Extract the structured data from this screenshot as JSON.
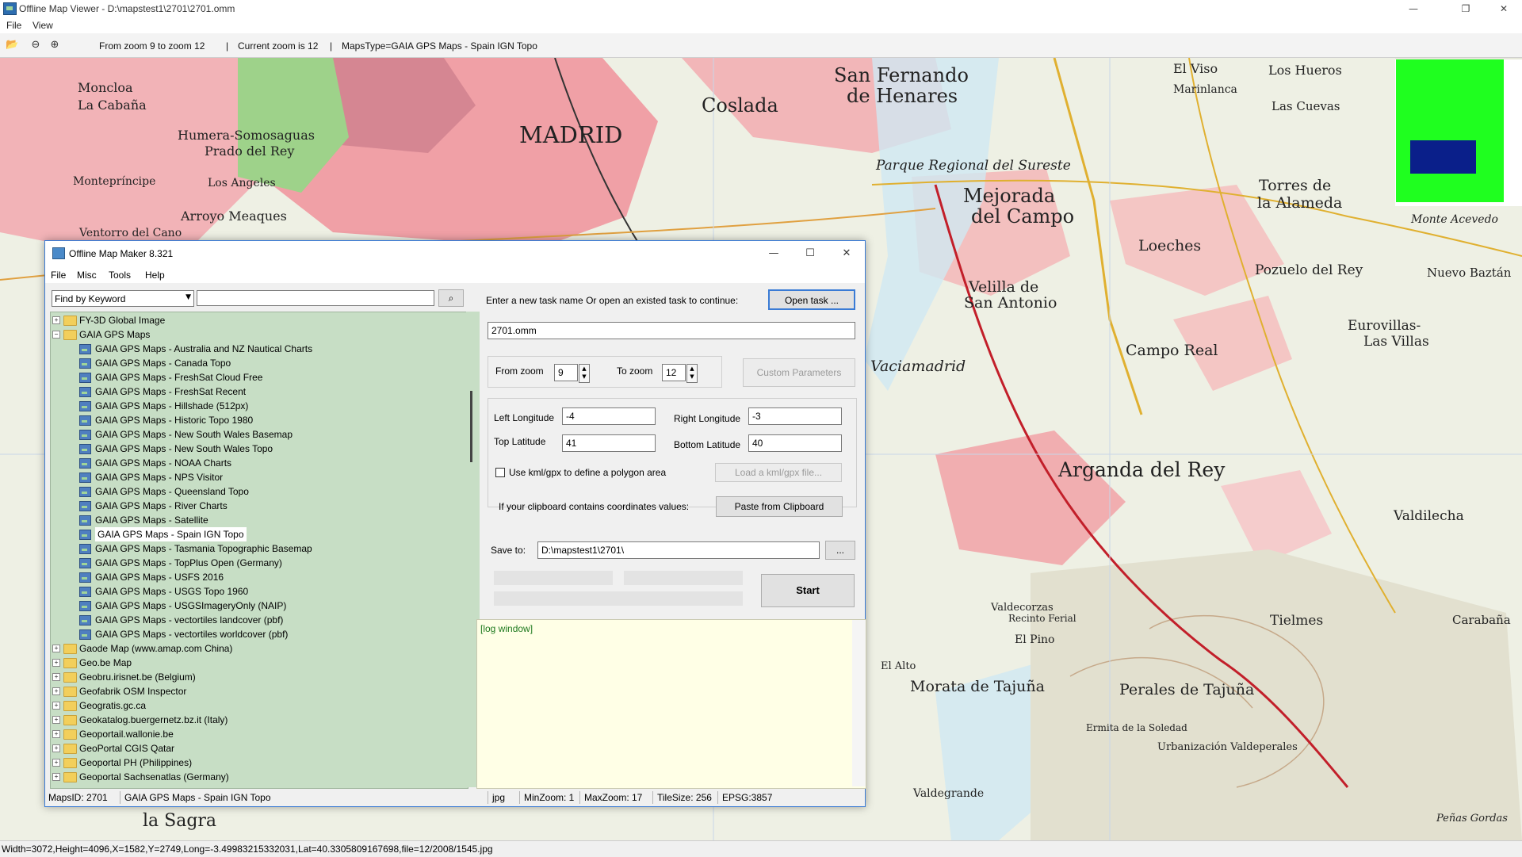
{
  "window": {
    "title": "Offline Map Viewer - D:\\mapstest1\\2701\\2701.omm",
    "controls": [
      "—",
      "❐",
      "✕"
    ]
  },
  "menu": [
    "File",
    "View"
  ],
  "toolbar": {
    "zoom_range": "From zoom 9 to zoom 12",
    "current_zoom": "Current zoom is 12",
    "maps_type": "MapsType=GAIA GPS Maps - Spain IGN Topo"
  },
  "map_labels": [
    "MADRID",
    "San Fernando",
    "de Henares",
    "Coslada",
    "Mejorada",
    "del Campo",
    "Loeches",
    "Torres de",
    "la Alameda",
    "Pozuelo del Rey",
    "Nuevo Baztán",
    "Velilla de",
    "San Antonio",
    "Campo Real",
    "Eurovillas-",
    "Las Villas",
    "Vaciamadrid",
    "Arganda del Rey",
    "Valdilecha",
    "Morata de Tajuña",
    "Perales de Tajuña",
    "Tielmes",
    "Carabaña",
    "Humera-Somosaguas",
    "Prado del Rey",
    "Arroyo Meaques",
    "Moncloa",
    "La Cabaña",
    "Montepríncipe",
    "Los Angeles",
    "Parque Regional del Sureste",
    "El Viso",
    "Los Hueros",
    "Marinlanca",
    "Las Cuevas",
    "Monte Acevedo",
    "Valdecorzas",
    "El Pino",
    "Recinto Ferial",
    "El Alto",
    "Valdegrande",
    "Peñas Gordas",
    "Ventorro del Cano",
    "la Sagra",
    "Urbanización Valdeperales",
    "Ermita de la Soledad"
  ],
  "overview": {
    "frame_color": "#1fff1f",
    "viewport_color": "#0a1f8a"
  },
  "status_bar": "Width=3072,Height=4096,X=1582,Y=2749,Long=-3.49983215332031,Lat=40.3305809167698,file=12/2008/1545.jpg",
  "dialog": {
    "title": "Offline Map Maker 8.321",
    "controls": [
      "—",
      "☐",
      "✕"
    ],
    "menu": [
      "File",
      "Misc",
      "Tools",
      "Help"
    ],
    "search": {
      "mode": "Find by Keyword",
      "query": "",
      "icon": "search-icon"
    },
    "tree": [
      {
        "label": "FY-3D Global Image",
        "level": 0,
        "type": "folder",
        "expander": "+"
      },
      {
        "label": "GAIA GPS Maps",
        "level": 0,
        "type": "folder",
        "expander": "−"
      },
      {
        "label": "GAIA GPS Maps - Australia and NZ Nautical Charts",
        "level": 1,
        "type": "map"
      },
      {
        "label": "GAIA GPS Maps - Canada Topo",
        "level": 1,
        "type": "map"
      },
      {
        "label": "GAIA GPS Maps - FreshSat Cloud Free",
        "level": 1,
        "type": "map"
      },
      {
        "label": "GAIA GPS Maps - FreshSat Recent",
        "level": 1,
        "type": "map"
      },
      {
        "label": "GAIA GPS Maps - Hillshade (512px)",
        "level": 1,
        "type": "map"
      },
      {
        "label": "GAIA GPS Maps - Historic Topo 1980",
        "level": 1,
        "type": "map"
      },
      {
        "label": "GAIA GPS Maps - New South Wales Basemap",
        "level": 1,
        "type": "map"
      },
      {
        "label": "GAIA GPS Maps - New South Wales Topo",
        "level": 1,
        "type": "map"
      },
      {
        "label": "GAIA GPS Maps - NOAA Charts",
        "level": 1,
        "type": "map"
      },
      {
        "label": "GAIA GPS Maps - NPS Visitor",
        "level": 1,
        "type": "map"
      },
      {
        "label": "GAIA GPS Maps - Queensland Topo",
        "level": 1,
        "type": "map"
      },
      {
        "label": "GAIA GPS Maps - River Charts",
        "level": 1,
        "type": "map"
      },
      {
        "label": "GAIA GPS Maps - Satellite",
        "level": 1,
        "type": "map"
      },
      {
        "label": "GAIA GPS Maps - Spain IGN Topo",
        "level": 1,
        "type": "map",
        "selected": true
      },
      {
        "label": "GAIA GPS Maps - Tasmania Topographic Basemap",
        "level": 1,
        "type": "map"
      },
      {
        "label": "GAIA GPS Maps - TopPlus Open (Germany)",
        "level": 1,
        "type": "map"
      },
      {
        "label": "GAIA GPS Maps - USFS 2016",
        "level": 1,
        "type": "map"
      },
      {
        "label": "GAIA GPS Maps - USGS Topo 1960",
        "level": 1,
        "type": "map"
      },
      {
        "label": "GAIA GPS Maps - USGSImageryOnly (NAIP)",
        "level": 1,
        "type": "map"
      },
      {
        "label": "GAIA GPS Maps - vectortiles landcover (pbf)",
        "level": 1,
        "type": "map"
      },
      {
        "label": "GAIA GPS Maps - vectortiles worldcover (pbf)",
        "level": 1,
        "type": "map"
      },
      {
        "label": "Gaode Map (www.amap.com China)",
        "level": 0,
        "type": "folder",
        "expander": "+"
      },
      {
        "label": "Geo.be Map",
        "level": 0,
        "type": "folder",
        "expander": "+"
      },
      {
        "label": "Geobru.irisnet.be (Belgium)",
        "level": 0,
        "type": "folder",
        "expander": "+"
      },
      {
        "label": "Geofabrik OSM Inspector",
        "level": 0,
        "type": "folder",
        "expander": "+"
      },
      {
        "label": "Geogratis.gc.ca",
        "level": 0,
        "type": "folder",
        "expander": "+"
      },
      {
        "label": "Geokatalog.buergernetz.bz.it (Italy)",
        "level": 0,
        "type": "folder",
        "expander": "+"
      },
      {
        "label": "Geoportail.wallonie.be",
        "level": 0,
        "type": "folder",
        "expander": "+"
      },
      {
        "label": "GeoPortal CGIS Qatar",
        "level": 0,
        "type": "folder",
        "expander": "+"
      },
      {
        "label": "Geoportal PH (Philippines)",
        "level": 0,
        "type": "folder",
        "expander": "+"
      },
      {
        "label": "Geoportal Sachsenatlas (Germany)",
        "level": 0,
        "type": "folder",
        "expander": "+"
      }
    ],
    "task": {
      "prompt": "Enter a new task name Or open an existed task to continue:",
      "open_button": "Open task ...",
      "name_value": "2701.omm"
    },
    "zoom": {
      "from_label": "From zoom",
      "from_value": "9",
      "to_label": "To zoom",
      "to_value": "12",
      "custom_button": "Custom Parameters"
    },
    "bounds": {
      "left_label": "Left Longitude",
      "left_value": "-4",
      "right_label": "Right Longitude",
      "right_value": "-3",
      "top_label": "Top Latitude",
      "top_value": "41",
      "bottom_label": "Bottom Latitude",
      "bottom_value": "40",
      "kml_checkbox": "Use kml/gpx to define a polygon area",
      "kml_button": "Load a kml/gpx file...",
      "clipboard_text": "If your clipboard contains coordinates values:",
      "clipboard_button": "Paste from Clipboard"
    },
    "save": {
      "label": "Save to:",
      "value": "D:\\mapstest1\\2701\\",
      "browse": "..."
    },
    "start_button": "Start",
    "log": "[log window]",
    "status": {
      "maps_id": "MapsID: 2701",
      "name": "GAIA GPS Maps - Spain IGN Topo",
      "format": "jpg",
      "min_zoom": "MinZoom: 1",
      "max_zoom": "MaxZoom: 17",
      "tile_size": "TileSize: 256",
      "epsg": "EPSG:3857"
    }
  }
}
